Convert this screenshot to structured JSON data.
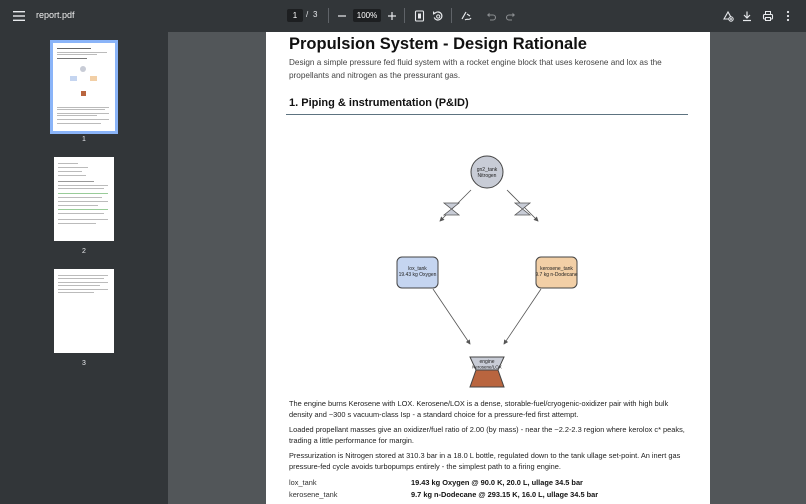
{
  "toolbar": {
    "title": "report.pdf",
    "current_page": "1",
    "page_separator": "/",
    "total_pages": "3",
    "zoom": "100%"
  },
  "sidebar": {
    "pages": [
      {
        "label": "1",
        "active": true
      },
      {
        "label": "2",
        "active": false
      },
      {
        "label": "3",
        "active": false
      }
    ]
  },
  "document": {
    "title": "Propulsion System - Design Rationale",
    "intro": "Design a simple pressure fed fluid system with a rocket engine block that uses kerosene and lox as the propellants and nitrogen as the pressurant gas.",
    "section1_title": "1. Piping & instrumentation (P&ID)",
    "diagram": {
      "gn2_tank_label": "gn2_tank",
      "gn2_tank_sub": "Nitrogen",
      "lox_tank_label": "lox_tank",
      "lox_tank_sub": "19.43 kg Oxygen",
      "kero_tank_label": "kerosene_tank",
      "kero_tank_sub": "9.7 kg n-Dodecane",
      "engine_label": "engine",
      "engine_sub": "Kerosene/LOX"
    },
    "para1": "The engine burns Kerosene with LOX. Kerosene/LOX is a dense, storable-fuel/cryogenic-oxidizer pair with high bulk density and ~300 s vacuum-class Isp - a standard choice for a pressure-fed first attempt.",
    "para2": "Loaded propellant masses give an oxidizer/fuel ratio of 2.00 (by mass) - near the ~2.2-2.3 region where kerolox c* peaks, trading a little performance for margin.",
    "para3": "Pressurization is Nitrogen stored at 310.3 bar in a 18.0 L bottle, regulated down to the tank ullage set-point. An inert gas pressure-fed cycle avoids turbopumps entirely - the simplest path to a firing engine.",
    "kv": [
      {
        "key": "lox_tank",
        "value": "19.43 kg Oxygen @ 90.0 K, 20.0 L, ullage 34.5 bar"
      },
      {
        "key": "kerosene_tank",
        "value": "9.7 kg n-Dodecane @ 293.15 K, 16.0 L, ullage 34.5 bar"
      }
    ]
  },
  "colors": {
    "toolbar_bg": "#323639",
    "viewer_bg": "#525659",
    "thumb_active": "#8ab4f8",
    "gn2_fill": "#c8ccd6",
    "lox_fill": "#c5d5f0",
    "kero_fill": "#f2cfa6",
    "engine_nozzle": "#b9653f"
  }
}
